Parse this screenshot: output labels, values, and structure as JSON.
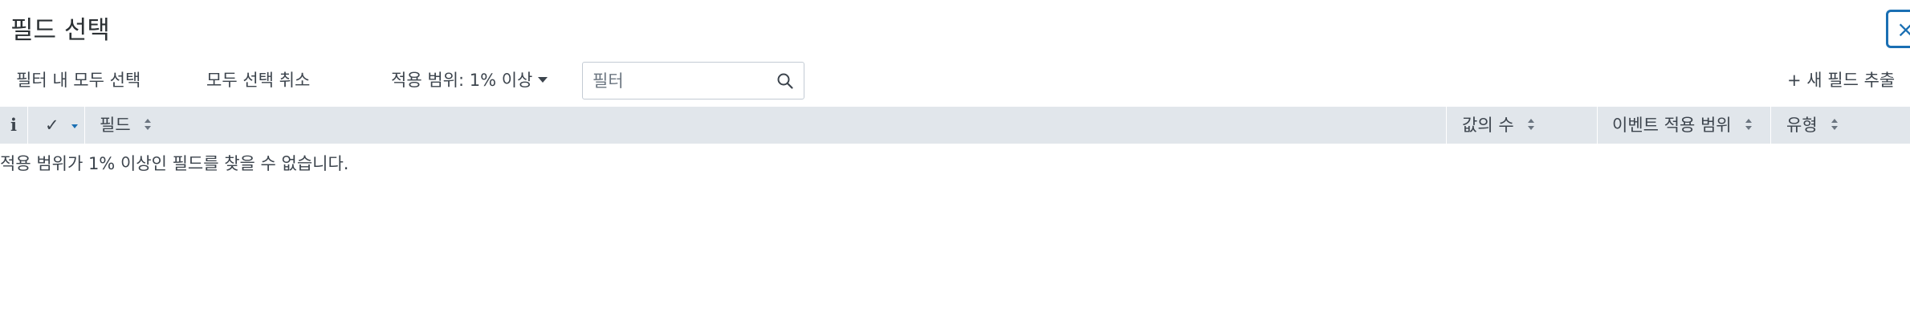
{
  "dialog": {
    "title": "필드 선택",
    "close_symbol": "×"
  },
  "toolbar": {
    "select_all_label": "필터 내 모두 선택",
    "deselect_all_label": "모두 선택 취소",
    "coverage_label": "적용 범위: 1% 이상",
    "filter_placeholder": "필터",
    "filter_value": "",
    "extract_new_field_label": "+ 새 필드 추출"
  },
  "table": {
    "columns": {
      "info": "i",
      "check": "✓",
      "field": "필드",
      "value_count": "값의 수",
      "event_coverage": "이벤트 적용 범위",
      "type": "유형"
    },
    "empty_message": "적용 범위가 1% 이상인 필드를 찾을 수 없습니다."
  },
  "icons": {
    "search": "search-icon",
    "close": "close-icon",
    "sort": "sort-icon",
    "caret": "caret-down-icon"
  },
  "colors": {
    "accent": "#1a6fb3",
    "header_bg": "#e1e6eb",
    "text": "#3c444d"
  }
}
